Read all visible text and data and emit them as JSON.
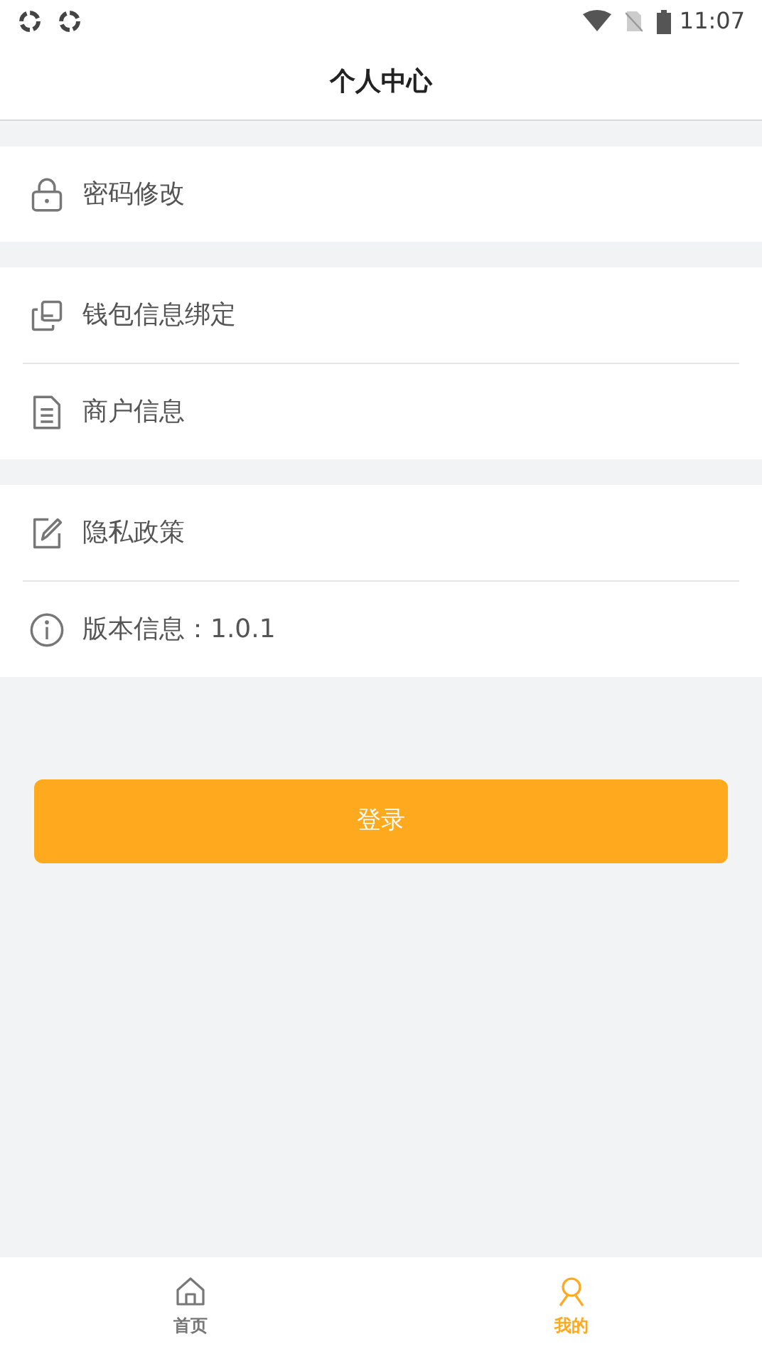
{
  "status_bar": {
    "time": "11:07"
  },
  "header": {
    "title": "个人中心"
  },
  "groups": [
    {
      "items": [
        {
          "kind": "lock",
          "label": "密码修改"
        }
      ]
    },
    {
      "items": [
        {
          "kind": "cards",
          "label": "钱包信息绑定"
        },
        {
          "kind": "document",
          "label": "商户信息"
        }
      ]
    },
    {
      "items": [
        {
          "kind": "edit",
          "label": "隐私政策"
        },
        {
          "kind": "info",
          "label": "版本信息：1.0.1"
        }
      ]
    }
  ],
  "login_button": {
    "label": "登录"
  },
  "tabs": [
    {
      "kind": "home",
      "label": "首页",
      "selected": false
    },
    {
      "kind": "person",
      "label": "我的",
      "selected": true
    }
  ]
}
